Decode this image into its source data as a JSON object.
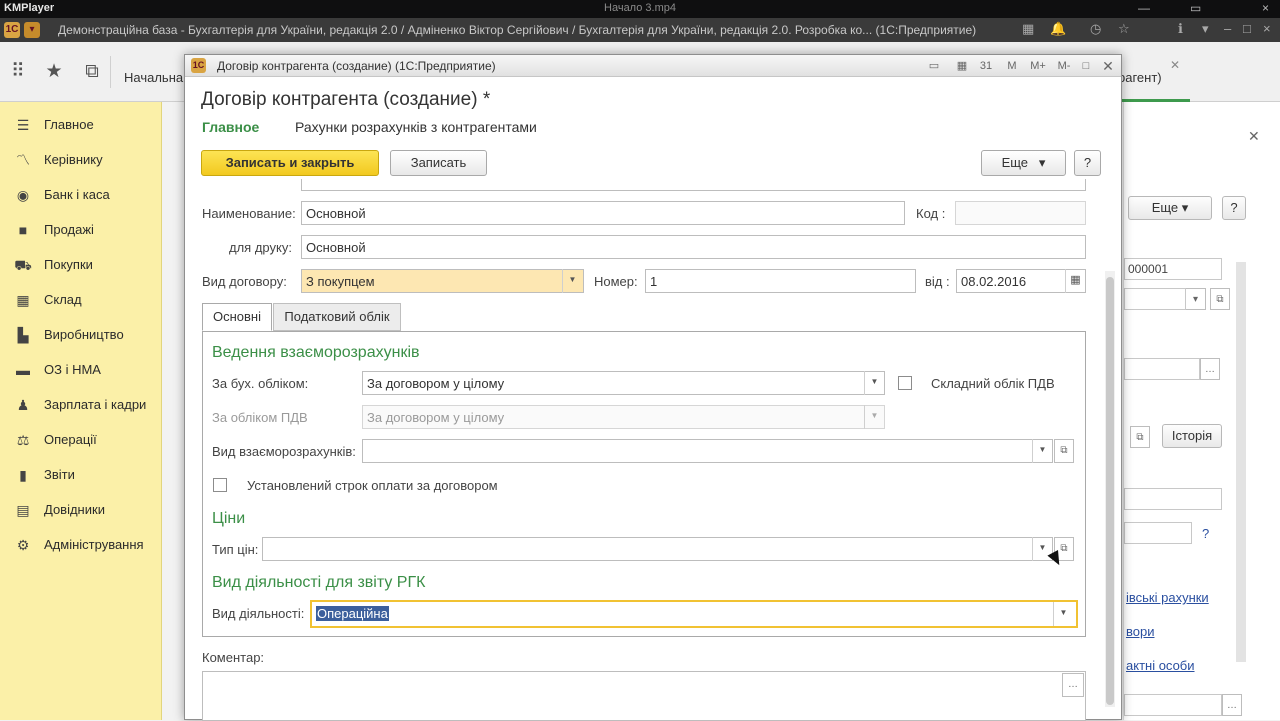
{
  "player": {
    "app_name": "KMPlayer",
    "file_name": "Начало 3.mp4",
    "controls": [
      "—",
      "▭",
      "×"
    ]
  },
  "main_window": {
    "title": "Демонстраційна база - Бухгалтерія для України, редакція 2.0 / Адміненко Віктор Сергійович / Бухгалтерія для України, редакція 2.0. Розробка ко... (1С:Предприятие)"
  },
  "toolbar": {
    "start_tab": "Начальна",
    "right_tab": "рагент)"
  },
  "sidebar": {
    "items": [
      {
        "label": "Главное",
        "icon": "menu-icon"
      },
      {
        "label": "Керівнику",
        "icon": "chart-icon"
      },
      {
        "label": "Банк і каса",
        "icon": "coin-icon"
      },
      {
        "label": "Продажі",
        "icon": "bag-icon"
      },
      {
        "label": "Покупки",
        "icon": "cart-icon"
      },
      {
        "label": "Склад",
        "icon": "grid-icon"
      },
      {
        "label": "Виробництво",
        "icon": "factory-icon"
      },
      {
        "label": "ОЗ і НМА",
        "icon": "truck-icon"
      },
      {
        "label": "Зарплата і кадри",
        "icon": "person-icon"
      },
      {
        "label": "Операції",
        "icon": "scale-icon"
      },
      {
        "label": "Звіти",
        "icon": "bar-chart-icon"
      },
      {
        "label": "Довідники",
        "icon": "book-icon"
      },
      {
        "label": "Адміністрування",
        "icon": "gear-icon"
      }
    ]
  },
  "background_panel": {
    "more_label": "Еще",
    "help_label": "?",
    "code_value": "000001",
    "history_label": "Історія",
    "question": "?",
    "links": [
      "івські рахунки",
      "вори",
      "актні особи"
    ]
  },
  "dialog": {
    "window_title": "Договір контрагента (создание)  (1С:Предприятие)",
    "title_controls": [
      "M",
      "M+",
      "M-"
    ],
    "heading": "Договір контрагента (создание) *",
    "nav": {
      "main": "Главное",
      "accounts": "Рахунки розрахунків з контрагентами"
    },
    "buttons": {
      "save_close": "Записать и закрыть",
      "save": "Записать",
      "more": "Еще",
      "help": "?"
    },
    "fields": {
      "name_label": "Наименование:",
      "name_value": "Основной",
      "code_label": "Код :",
      "code_value": "",
      "print_label": "для друку:",
      "print_value": "Основной",
      "type_label": "Вид договору:",
      "type_value": "З покупцем",
      "number_label": "Номер:",
      "number_value": "1",
      "date_label": "від :",
      "date_value": "08.02.2016"
    },
    "tabs": [
      "Основні",
      "Податковий облік"
    ],
    "settlements": {
      "section_title": "Ведення взаєморозрахунків",
      "acc_label": "За бух. обліком:",
      "acc_value": "За договором у цілому",
      "vat_complex_label": "Складний облік ПДВ",
      "vat_label": "За обліком ПДВ",
      "vat_value": "За договором у цілому",
      "kind_label": "Вид взаєморозрахунків:",
      "kind_value": "",
      "term_label": "Установлений строк оплати за договором"
    },
    "prices": {
      "section_title": "Ціни",
      "type_label": "Тип цін:",
      "type_value": ""
    },
    "activity": {
      "section_title": "Вид діяльності для звіту РГК",
      "label": "Вид діяльності:",
      "value": "Операційна"
    },
    "comment_label": "Коментар:"
  }
}
